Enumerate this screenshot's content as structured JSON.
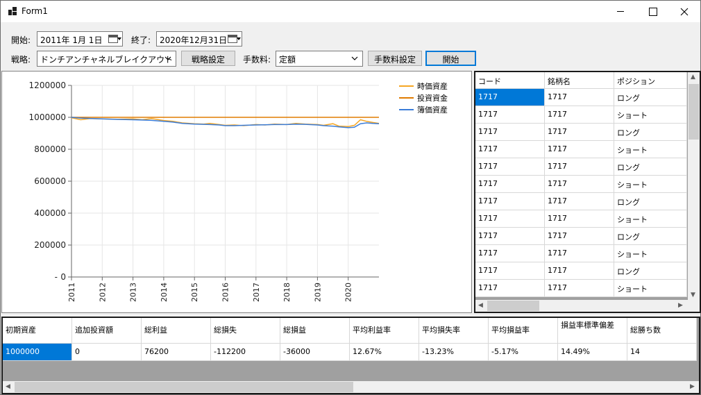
{
  "window": {
    "title": "Form1"
  },
  "toolbar": {
    "start_label": "開始:",
    "start_date": "2011年  1月  1日",
    "end_label": "終了:",
    "end_date": "2020年12月31日",
    "strategy_label": "戦略:",
    "strategy_value": "ドンチアンチャネルブレイクアウト",
    "strategy_settings_button": "戦略設定",
    "fee_label": "手数料:",
    "fee_value": "定額",
    "fee_settings_button": "手数料設定",
    "start_button": "開始"
  },
  "chart_data": {
    "type": "line",
    "x_ticks": [
      "2011",
      "2012",
      "2013",
      "2014",
      "2015",
      "2016",
      "2017",
      "2018",
      "2019",
      "2020"
    ],
    "y_ticks": [
      "1200000",
      "1000000",
      "800000",
      "600000",
      "400000",
      "200000",
      "0"
    ],
    "ylim": [
      0,
      1200000
    ],
    "xlim": [
      2011,
      2021
    ],
    "grid": true,
    "legend_position": "top-right",
    "colors": {
      "market": "#f5a623",
      "invest": "#e07b00",
      "book": "#3a7cd8"
    },
    "series": [
      {
        "name": "時価資産",
        "x": [
          2011.0,
          2011.3,
          2011.6,
          2012.0,
          2012.5,
          2013.0,
          2013.3,
          2013.6,
          2014.0,
          2014.3,
          2014.6,
          2015.0,
          2015.3,
          2015.5,
          2015.8,
          2016.0,
          2016.3,
          2016.6,
          2017.0,
          2017.3,
          2017.6,
          2018.0,
          2018.3,
          2018.6,
          2019.0,
          2019.2,
          2019.5,
          2019.7,
          2020.0,
          2020.2,
          2020.4,
          2020.6,
          2020.8,
          2021.0
        ],
        "values": [
          997000,
          985000,
          992000,
          990000,
          988000,
          990000,
          985000,
          992000,
          980000,
          975000,
          965000,
          960000,
          958000,
          962000,
          955000,
          950000,
          952000,
          948000,
          955000,
          952000,
          958000,
          955000,
          962000,
          958000,
          955000,
          950000,
          960000,
          945000,
          942000,
          950000,
          985000,
          975000,
          968000,
          962000
        ]
      },
      {
        "name": "投資資金",
        "x": [
          2011.0,
          2021.0
        ],
        "values": [
          1000000,
          1000000
        ]
      },
      {
        "name": "簿価資産",
        "x": [
          2011.0,
          2011.3,
          2011.6,
          2012.0,
          2012.5,
          2013.0,
          2013.3,
          2013.6,
          2014.0,
          2014.3,
          2014.6,
          2015.0,
          2015.3,
          2015.5,
          2015.8,
          2016.0,
          2016.3,
          2016.6,
          2017.0,
          2017.3,
          2017.6,
          2018.0,
          2018.3,
          2018.6,
          2019.0,
          2019.2,
          2019.5,
          2019.7,
          2020.0,
          2020.2,
          2020.4,
          2020.6,
          2020.8,
          2021.0
        ],
        "values": [
          1000000,
          995000,
          993000,
          990000,
          987000,
          985000,
          983000,
          981000,
          975000,
          970000,
          962000,
          958000,
          956000,
          955000,
          952000,
          948000,
          948000,
          950000,
          952000,
          953000,
          955000,
          955000,
          957000,
          956000,
          952000,
          948000,
          945000,
          940000,
          935000,
          938000,
          960000,
          965000,
          962000,
          960000
        ]
      }
    ]
  },
  "trades_grid": {
    "columns": [
      "コード",
      "銘柄名",
      "ポジション"
    ],
    "rows": [
      [
        "1717",
        "1717",
        "ロング"
      ],
      [
        "1717",
        "1717",
        "ショート"
      ],
      [
        "1717",
        "1717",
        "ロング"
      ],
      [
        "1717",
        "1717",
        "ショート"
      ],
      [
        "1717",
        "1717",
        "ロング"
      ],
      [
        "1717",
        "1717",
        "ショート"
      ],
      [
        "1717",
        "1717",
        "ロング"
      ],
      [
        "1717",
        "1717",
        "ショート"
      ],
      [
        "1717",
        "1717",
        "ロング"
      ],
      [
        "1717",
        "1717",
        "ショート"
      ],
      [
        "1717",
        "1717",
        "ロング"
      ],
      [
        "1717",
        "1717",
        "ショート"
      ]
    ]
  },
  "summary_grid": {
    "columns": [
      "初期資産",
      "追加投資額",
      "総利益",
      "総損失",
      "総損益",
      "平均利益率",
      "平均損失率",
      "平均損益率",
      "損益率標準偏差",
      "総勝ち数"
    ],
    "row": [
      "1000000",
      "0",
      "76200",
      "-112200",
      "-36000",
      "12.67%",
      "-13.23%",
      "-5.17%",
      "14.49%",
      "14"
    ]
  }
}
